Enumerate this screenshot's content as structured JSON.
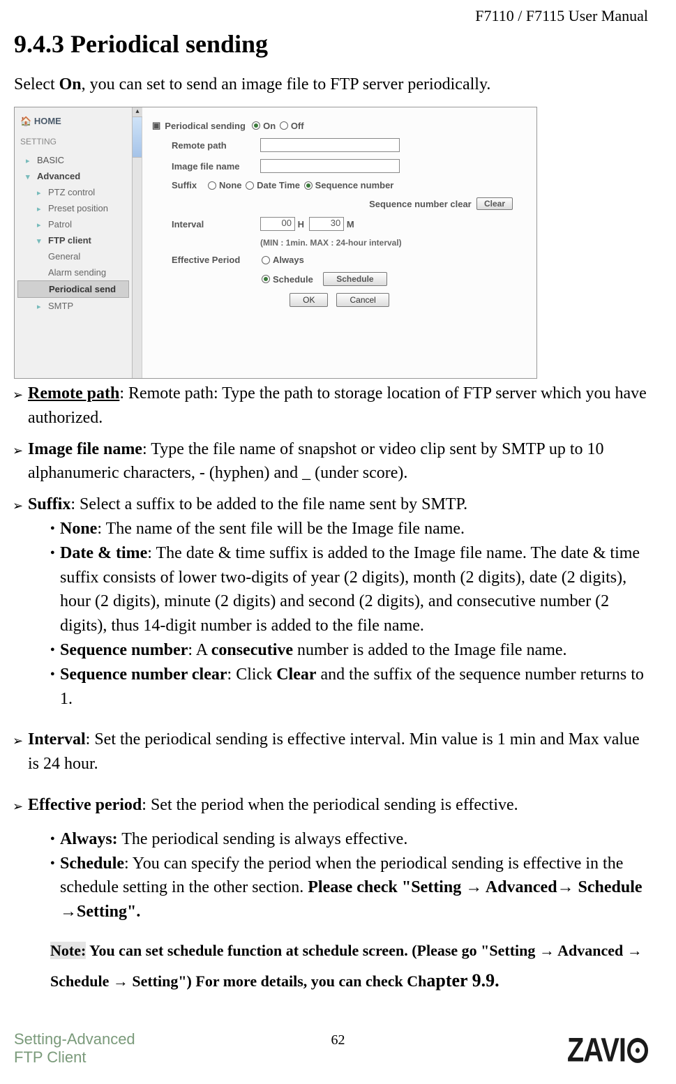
{
  "header": {
    "doc_title": "F7110 / F7115 User Manual"
  },
  "section": {
    "number_title": "9.4.3 Periodical sending"
  },
  "intro": {
    "pre": "Select ",
    "on": "On",
    "post": ", you can set to send an image file to FTP server periodically."
  },
  "screenshot": {
    "nav": {
      "home": "HOME",
      "setting": "SETTING",
      "basic": "BASIC",
      "advanced": "Advanced",
      "items": {
        "ptz": "PTZ control",
        "preset": "Preset position",
        "patrol": "Patrol",
        "ftp": "FTP client",
        "general": "General",
        "alarm": "Alarm sending",
        "periodical": "Periodical send",
        "smtp": "SMTP"
      }
    },
    "main": {
      "periodical_label": "Periodical sending",
      "on": "On",
      "off": "Off",
      "remote_path": "Remote path",
      "image_file": "Image file name",
      "suffix": "Suffix",
      "none": "None",
      "date_time": "Date Time",
      "seq_num": "Sequence number",
      "seq_clear_label": "Sequence number clear",
      "clear_btn": "Clear",
      "interval": "Interval",
      "interval_h_val": "00",
      "interval_h_unit": "H",
      "interval_m_val": "30",
      "interval_m_unit": "M",
      "interval_hint": "(MIN : 1min. MAX : 24-hour interval)",
      "effective": "Effective Period",
      "always": "Always",
      "schedule": "Schedule",
      "schedule_btn": "Schedule",
      "ok": "OK",
      "cancel": "Cancel"
    }
  },
  "items": {
    "remote_path": {
      "label": "Remote path",
      "text": ": Remote path: Type the path to storage location of FTP server which you have authorized."
    },
    "image_file": {
      "label": "Image file name",
      "text": ": Type the file name of snapshot or video clip sent by SMTP up to 10 alphanumeric characters, - (hyphen) and _ (under score)."
    },
    "suffix": {
      "label": "Suffix",
      "text": ": Select a suffix to be added to the file name sent by SMTP.",
      "none": {
        "label": "None",
        "text": ": The name of the sent file will be the Image file name."
      },
      "dt": {
        "label": "Date & time",
        "text": ": The date & time suffix is added to the Image file name. The date & time suffix consists of lower two-digits of year (2 digits), month (2 digits), date (2 digits), hour (2 digits), minute (2 digits) and second (2 digits), and consecutive number (2 digits), thus 14-digit number is added to the file name."
      },
      "sn": {
        "label": "Sequence number",
        "pre": ": A ",
        "b": "consecutive",
        "post": " number is added to the Image file name."
      },
      "snc": {
        "label": "Sequence number clear",
        "pre": ": Click ",
        "b": "Clear",
        "post": " and the suffix of the sequence number returns to 1."
      }
    },
    "interval": {
      "label": "Interval",
      "text": ": Set the periodical sending is effective interval. Min value is 1 min and Max value is 24 hour."
    },
    "effective": {
      "label": "Effective period",
      "text": ": Set the period when the periodical sending is effective.",
      "always": {
        "label": "Always:",
        "text": " The periodical sending is always effective."
      },
      "schedule": {
        "label": "Schedule",
        "pre": ": You can specify the period when the periodical sending is effective in the schedule setting in the other section. ",
        "b": "Please check \"Setting → Advanced→ Schedule →Setting\"."
      }
    },
    "note": {
      "label": "Note:",
      "part1": " You can set schedule function at schedule screen. (Please go \"Setting → Advanced → Schedule → Setting\") For more details, you can check Ch",
      "part2": "apter 9.9."
    }
  },
  "footer": {
    "left_line1": "Setting-Advanced",
    "left_line2": "FTP Client",
    "page_number": "62",
    "logo": "ZAVI"
  }
}
